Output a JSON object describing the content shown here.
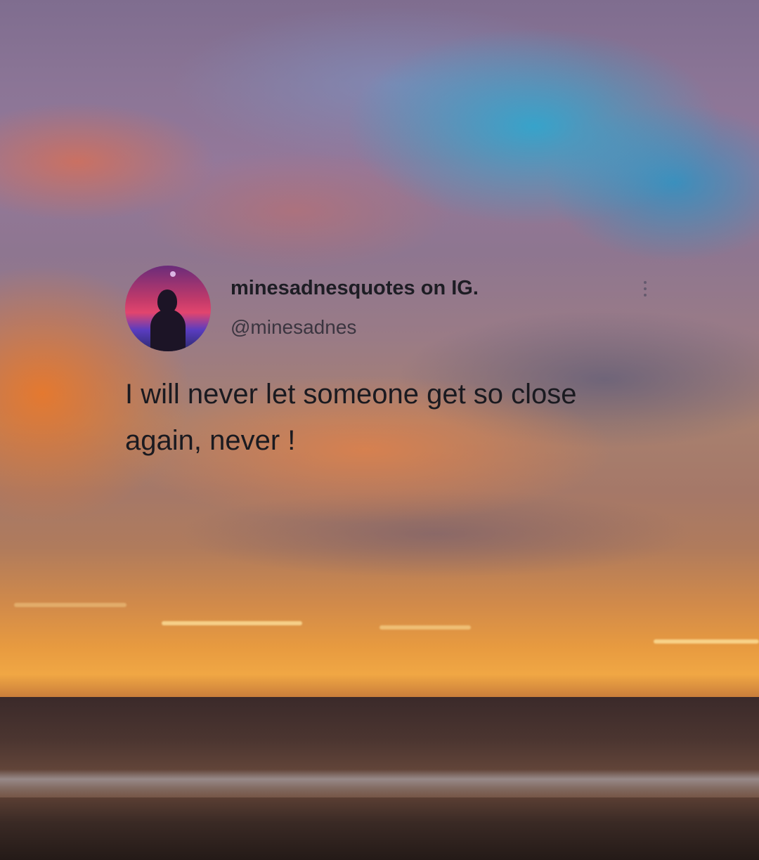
{
  "post": {
    "display_name": "minesadnesquotes on IG.",
    "handle": "@minesadnes",
    "text": "I will never let someone get so close again, never !",
    "avatar_icon": "profile-avatar",
    "more_icon": "more-dots-icon"
  },
  "colors": {
    "text_primary": "#1a1a20",
    "text_secondary": "#3b3540",
    "sky_blue": "#28aad2",
    "sunset_orange": "#f0a744"
  }
}
